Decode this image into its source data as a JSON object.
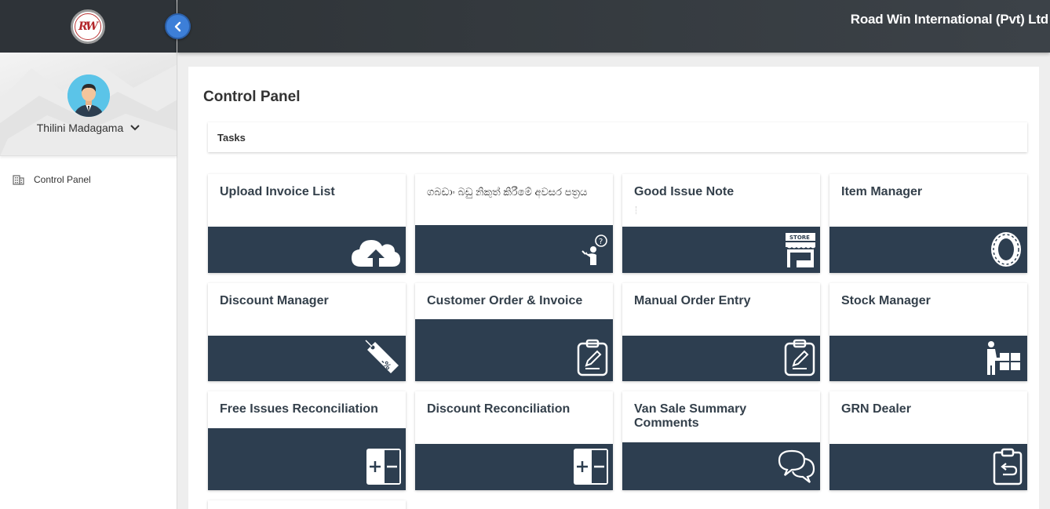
{
  "header": {
    "company": "Road Win International (Pvt) Ltd"
  },
  "sidebar": {
    "user_name": "Thilini Madagama",
    "items": [
      {
        "label": "Control Panel",
        "icon": "building-icon"
      }
    ]
  },
  "main": {
    "page_title": "Control Panel",
    "section_title": "Tasks",
    "cards": [
      {
        "title": "Upload Invoice List",
        "icon": "cloud-upload-icon"
      },
      {
        "title": "ගබඩාං බඩු නිකුත් කිරීමේ අවසර පත්‍රය",
        "icon": "person-question-icon"
      },
      {
        "title": "Good Issue Note",
        "icon": "store-icon"
      },
      {
        "title": "Item Manager",
        "icon": "tire-icon"
      },
      {
        "title": "Discount Manager",
        "icon": "discount-tag-icon"
      },
      {
        "title": "Customer Order & Invoice",
        "icon": "clipboard-edit-icon"
      },
      {
        "title": "Manual Order Entry",
        "icon": "clipboard-edit-icon"
      },
      {
        "title": "Stock Manager",
        "icon": "person-boxes-icon"
      },
      {
        "title": "Free Issues Reconciliation",
        "icon": "plus-minus-icon"
      },
      {
        "title": "Discount Reconciliation",
        "icon": "plus-minus-icon"
      },
      {
        "title": "Van Sale Summary Comments",
        "icon": "chat-bubbles-icon"
      },
      {
        "title": "GRN Dealer",
        "icon": "clipboard-return-icon"
      }
    ]
  }
}
